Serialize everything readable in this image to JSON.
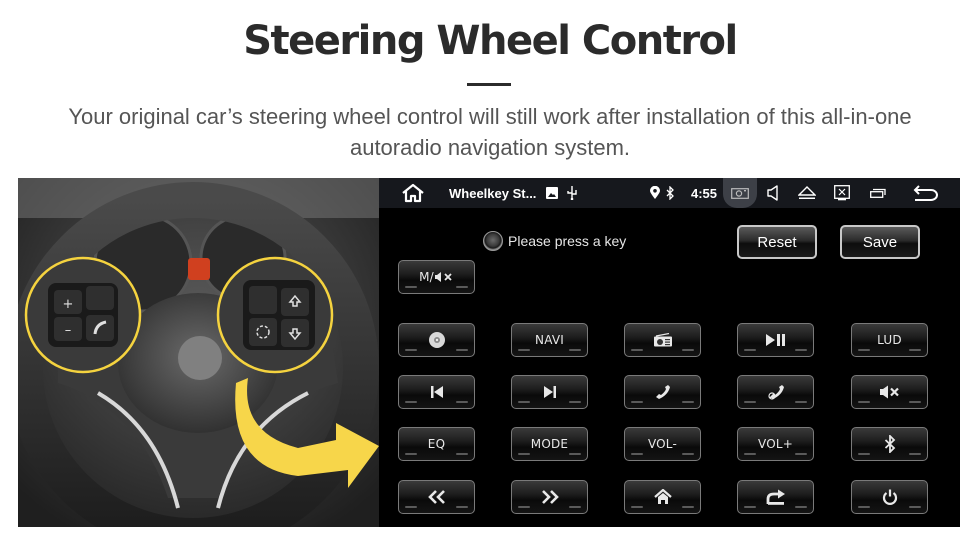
{
  "page": {
    "headline": "Steering Wheel Control",
    "subtitle_line1": "Your original car’s steering wheel control will still work after installation of this all-in-one",
    "subtitle_line2": "autoradio navigation system."
  },
  "photo": {
    "description": "steering wheel with highlighted control buttons",
    "accent_color": "#f5d33f",
    "left_cluster_buttons": [
      "vol-up",
      "voice",
      "vol-down",
      "phone"
    ],
    "left_cluster_labels": [
      "+",
      "–"
    ],
    "right_cluster_buttons": [
      "mode",
      "up",
      "source",
      "down"
    ]
  },
  "statusbar": {
    "home_icon": "home-icon",
    "title": "Wheelkey St...",
    "notification_icons": [
      "image-icon",
      "usb-icon"
    ],
    "location_icon": "location-icon",
    "bluetooth_icon": "bluetooth-icon",
    "time": "4:55",
    "right_icons": [
      "camera-icon",
      "volume-icon",
      "eject-icon",
      "close-window-icon",
      "recent-apps-icon",
      "back-icon"
    ]
  },
  "screen": {
    "prompt": "Please press a key",
    "reset_label": "Reset",
    "save_label": "Save",
    "mute_mode_label": "M/",
    "keys": [
      {
        "id": "disc",
        "label": "",
        "icon": "disc-icon"
      },
      {
        "id": "navi",
        "label": "NAVI",
        "icon": ""
      },
      {
        "id": "radio",
        "label": "",
        "icon": "radio-icon"
      },
      {
        "id": "play-pause",
        "label": "",
        "icon": "play-pause-icon"
      },
      {
        "id": "lud",
        "label": "LUD",
        "icon": ""
      },
      {
        "id": "prev",
        "label": "",
        "icon": "skip-previous-icon"
      },
      {
        "id": "next",
        "label": "",
        "icon": "skip-next-icon"
      },
      {
        "id": "call",
        "label": "",
        "icon": "phone-answer-icon"
      },
      {
        "id": "hangup",
        "label": "",
        "icon": "phone-hangup-icon"
      },
      {
        "id": "mute",
        "label": "",
        "icon": "mute-icon"
      },
      {
        "id": "eq",
        "label": "EQ",
        "icon": ""
      },
      {
        "id": "mode",
        "label": "MODE",
        "icon": ""
      },
      {
        "id": "vol-down",
        "label": "VOL-",
        "icon": ""
      },
      {
        "id": "vol-up",
        "label": "VOL+",
        "icon": ""
      },
      {
        "id": "bluetooth",
        "label": "",
        "icon": "bluetooth-icon"
      },
      {
        "id": "rewind",
        "label": "",
        "icon": "rewind-icon"
      },
      {
        "id": "fast-forward",
        "label": "",
        "icon": "fast-forward-icon"
      },
      {
        "id": "home",
        "label": "",
        "icon": "home-icon"
      },
      {
        "id": "return",
        "label": "",
        "icon": "return-icon"
      },
      {
        "id": "power",
        "label": "",
        "icon": "power-icon"
      }
    ]
  }
}
